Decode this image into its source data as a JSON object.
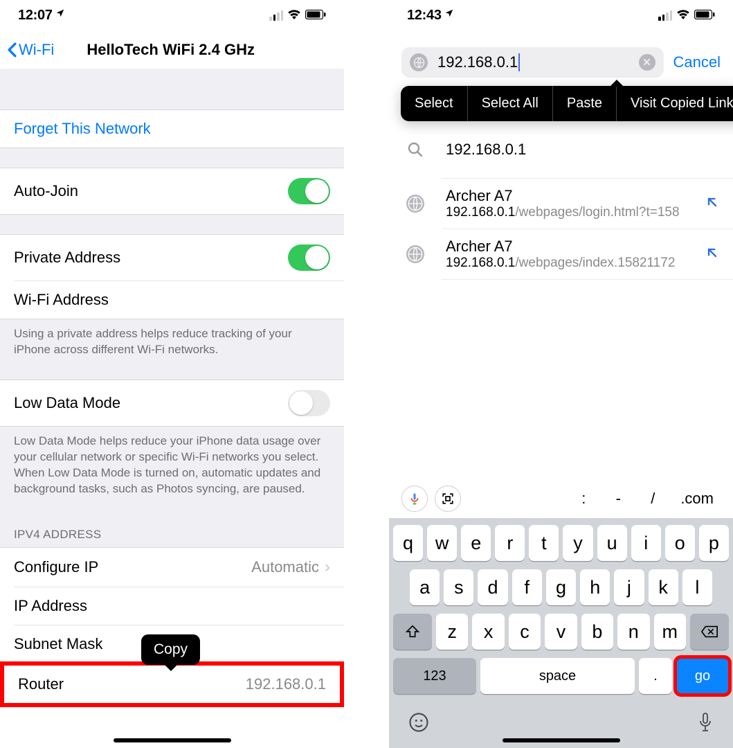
{
  "left": {
    "status": {
      "time": "12:07"
    },
    "nav": {
      "back": "Wi-Fi",
      "title": "HelloTech WiFi 2.4 GHz"
    },
    "forget": "Forget This Network",
    "autojoin": {
      "label": "Auto-Join"
    },
    "private": {
      "label": "Private Address"
    },
    "wifiaddr": {
      "label": "Wi-Fi Address"
    },
    "private_footer": "Using a private address helps reduce tracking of your iPhone across different Wi-Fi networks.",
    "lowdata": {
      "label": "Low Data Mode"
    },
    "lowdata_footer": "Low Data Mode helps reduce your iPhone data usage over your cellular network or specific Wi-Fi networks you select. When Low Data Mode is turned on, automatic updates and background tasks, such as Photos syncing, are paused.",
    "ipv4_header": "IPV4 ADDRESS",
    "configip": {
      "label": "Configure IP",
      "value": "Automatic"
    },
    "ipaddr": {
      "label": "IP Address"
    },
    "subnet": {
      "label": "Subnet Mask"
    },
    "router": {
      "label": "Router",
      "value": "192.168.0.1"
    },
    "copy_popover": "Copy"
  },
  "right": {
    "status": {
      "time": "12:43"
    },
    "search": {
      "value": "192.168.0.1",
      "cancel": "Cancel"
    },
    "context_menu": [
      "Select",
      "Select All",
      "Paste",
      "Visit Copied Link"
    ],
    "suggestions": [
      {
        "kind": "history",
        "title": "192.168.0.1"
      },
      {
        "kind": "search",
        "title": "192.168.0.1"
      },
      {
        "kind": "page",
        "title": "Archer A7",
        "url_host": "192.168.0.1",
        "url_path": "/webpages/login.html?t=158"
      },
      {
        "kind": "page",
        "title": "Archer A7",
        "url_host": "192.168.0.1",
        "url_path": "/webpages/index.15821172"
      }
    ],
    "keyboard": {
      "top_punct": [
        ":",
        "-",
        "/",
        ".com"
      ],
      "rows": [
        [
          "q",
          "w",
          "e",
          "r",
          "t",
          "y",
          "u",
          "i",
          "o",
          "p"
        ],
        [
          "a",
          "s",
          "d",
          "f",
          "g",
          "h",
          "j",
          "k",
          "l"
        ],
        [
          "z",
          "x",
          "c",
          "v",
          "b",
          "n",
          "m"
        ]
      ],
      "num_key": "123",
      "space_key": "space",
      "period_key": ".",
      "go_key": "go"
    }
  }
}
